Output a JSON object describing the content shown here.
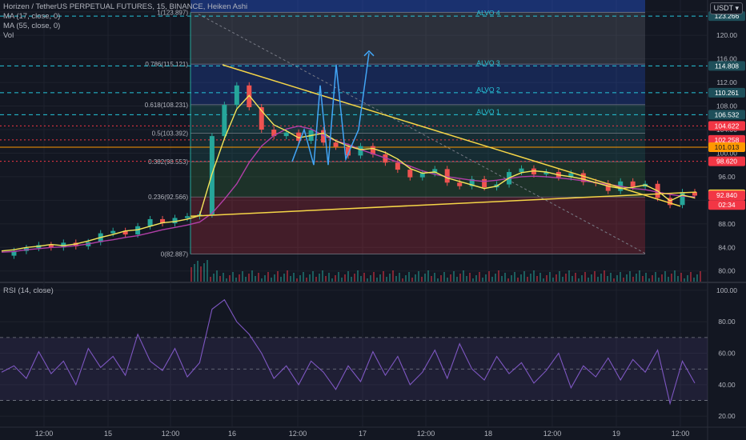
{
  "header": {
    "title": "Horizen / TetherUS PERPETUAL FUTURES, 15, BINANCE, Heiken Ashi",
    "ma1": "MA (17, close, 0)",
    "ma2": "MA (55, close, 0)",
    "vol": "Vol",
    "currency": "USDT",
    "settings_icon": "settings-icon"
  },
  "colors": {
    "background": "#131722",
    "grid": "#1e222d",
    "ma17": "#f5e65a",
    "ma55": "#b13fa8",
    "rsi": "#7e57c2",
    "fib_line": "#26c6da",
    "red_level": "#f23645",
    "orange_level": "#ff9800",
    "trendline": "#f5d547",
    "projection": "#42a5f5"
  },
  "chart_data": [
    {
      "type": "candlestick",
      "title": "Horizen / TetherUS PERPETUAL FUTURES, 15, BINANCE, Heiken Ashi",
      "x_ticks": [
        "12:00",
        "15",
        "12:00",
        "16",
        "12:00",
        "17",
        "12:00",
        "18",
        "12:00",
        "19",
        "12:00"
      ],
      "y_ticks": [
        80,
        84,
        88,
        92,
        96,
        100,
        104,
        108,
        112,
        116,
        120,
        124
      ],
      "ylim": [
        78.2,
        126.0
      ],
      "series": [
        {
          "name": "MA (17, close, 0)",
          "values": [
            83.4,
            83.6,
            84.0,
            84.2,
            84.5,
            84.3,
            84.6,
            85.1,
            85.7,
            86.2,
            86.8,
            87.0,
            87.6,
            88.2,
            88.4,
            88.8,
            89.4,
            96.5,
            102.5,
            107.5,
            109.8,
            107.2,
            104.8,
            103.8,
            102.6,
            103.0,
            103.4,
            102.1,
            101.2,
            100.6,
            100.8,
            100.1,
            99.0,
            97.4,
            96.6,
            96.8,
            95.8,
            95.2,
            94.6,
            94.0,
            94.4,
            95.8,
            96.7,
            97.0,
            96.8,
            96.3,
            96.0,
            95.6,
            95.0,
            94.4,
            94.0,
            94.2,
            94.6,
            93.6,
            91.9,
            92.9,
            92.4
          ]
        },
        {
          "name": "MA (55, close, 0)",
          "values": [
            83.2,
            83.3,
            83.6,
            83.8,
            84.0,
            84.1,
            84.3,
            84.6,
            85.0,
            85.3,
            85.7,
            86.0,
            86.5,
            87.0,
            87.4,
            87.8,
            88.3,
            89.8,
            92.2,
            94.8,
            98.4,
            101.2,
            103.0,
            104.1,
            104.6,
            104.1,
            103.0,
            102.1,
            101.5,
            100.6,
            99.9,
            99.2,
            98.5,
            97.8,
            97.0,
            96.4,
            96.0,
            95.7,
            95.4,
            95.2,
            95.4,
            95.7,
            96.0,
            96.1,
            96.0,
            95.8,
            95.6,
            95.3,
            95.0,
            94.7,
            94.4,
            94.0,
            93.8,
            93.4,
            93.0,
            92.7,
            92.6
          ]
        },
        {
          "name": "price",
          "values": [
            82.6,
            83.4,
            83.9,
            84.4,
            84.0,
            84.8,
            84.2,
            84.9,
            86.4,
            86.8,
            86.2,
            87.6,
            88.8,
            88.1,
            89.0,
            89.3,
            89.6,
            102.9,
            108.2,
            111.5,
            107.8,
            104.0,
            102.9,
            103.5,
            102.1,
            103.9,
            101.8,
            101.1,
            99.6,
            101.2,
            99.8,
            98.4,
            97.2,
            95.9,
            96.6,
            97.3,
            95.0,
            94.4,
            95.6,
            94.2,
            94.7,
            96.8,
            97.4,
            96.4,
            96.8,
            95.9,
            96.6,
            95.1,
            94.9,
            93.6,
            95.2,
            94.3,
            94.8,
            92.4,
            91.2,
            93.4,
            92.8
          ]
        }
      ],
      "levels": [
        {
          "label": "106.532",
          "value": 106.532,
          "color": "#26c6da"
        },
        {
          "label": "104.622",
          "value": 104.622,
          "color": "#f23645"
        },
        {
          "label": "102.258",
          "value": 102.258,
          "color": "#f23645"
        },
        {
          "label": "101.013",
          "value": 101.013,
          "color": "#ff9800"
        },
        {
          "label": "98.620",
          "value": 98.62,
          "color": "#f23645"
        },
        {
          "label": "110.261",
          "value": 110.261,
          "color": "#26c6da"
        },
        {
          "label": "114.808",
          "value": 114.808,
          "color": "#26c6da"
        },
        {
          "label": "123.266",
          "value": 123.266,
          "color": "#26c6da"
        },
        {
          "label": "93.020",
          "value": 93.02,
          "color": "#f5d547"
        },
        {
          "label": "92.840",
          "value": 92.84,
          "color": "#f23645"
        }
      ],
      "countdown": "02:34",
      "fib_levels": [
        {
          "ratio": "1",
          "value": 123.897,
          "text": "1(123.897)"
        },
        {
          "ratio": "0.786",
          "value": 115.121,
          "text": "0.786(115.121)"
        },
        {
          "ratio": "0.618",
          "value": 108.231,
          "text": "0.618(108.231)"
        },
        {
          "ratio": "0.5",
          "value": 103.392,
          "text": "0.5(103.392)"
        },
        {
          "ratio": "0.382",
          "value": 98.553,
          "text": "0.382(98.553)"
        },
        {
          "ratio": "0.236",
          "value": 92.566,
          "text": "0.236(92.566)"
        },
        {
          "ratio": "0",
          "value": 82.887,
          "text": "0(82.887)"
        }
      ],
      "targets": [
        {
          "label": "ALVO 4",
          "value": 123.266
        },
        {
          "label": "ALVO 3",
          "value": 114.808
        },
        {
          "label": "ALVO 2",
          "value": 110.261
        },
        {
          "label": "ALVO 1",
          "value": 106.532
        }
      ]
    },
    {
      "type": "line",
      "title": "RSI (14, close)",
      "y_ticks": [
        20,
        40,
        60,
        80,
        100
      ],
      "ylim": [
        13,
        104
      ],
      "bands": [
        30,
        50,
        70
      ],
      "series": [
        {
          "name": "RSI (14, close)",
          "values": [
            48,
            52,
            44,
            61,
            47,
            55,
            40,
            63,
            51,
            58,
            46,
            72,
            55,
            49,
            63,
            45,
            54,
            88,
            94,
            80,
            72,
            60,
            44,
            52,
            40,
            55,
            48,
            37,
            52,
            42,
            61,
            46,
            58,
            40,
            48,
            62,
            44,
            66,
            50,
            43,
            58,
            47,
            54,
            41,
            49,
            60,
            38,
            52,
            45,
            57,
            43,
            56,
            48,
            62,
            28,
            55,
            41
          ]
        }
      ]
    }
  ]
}
